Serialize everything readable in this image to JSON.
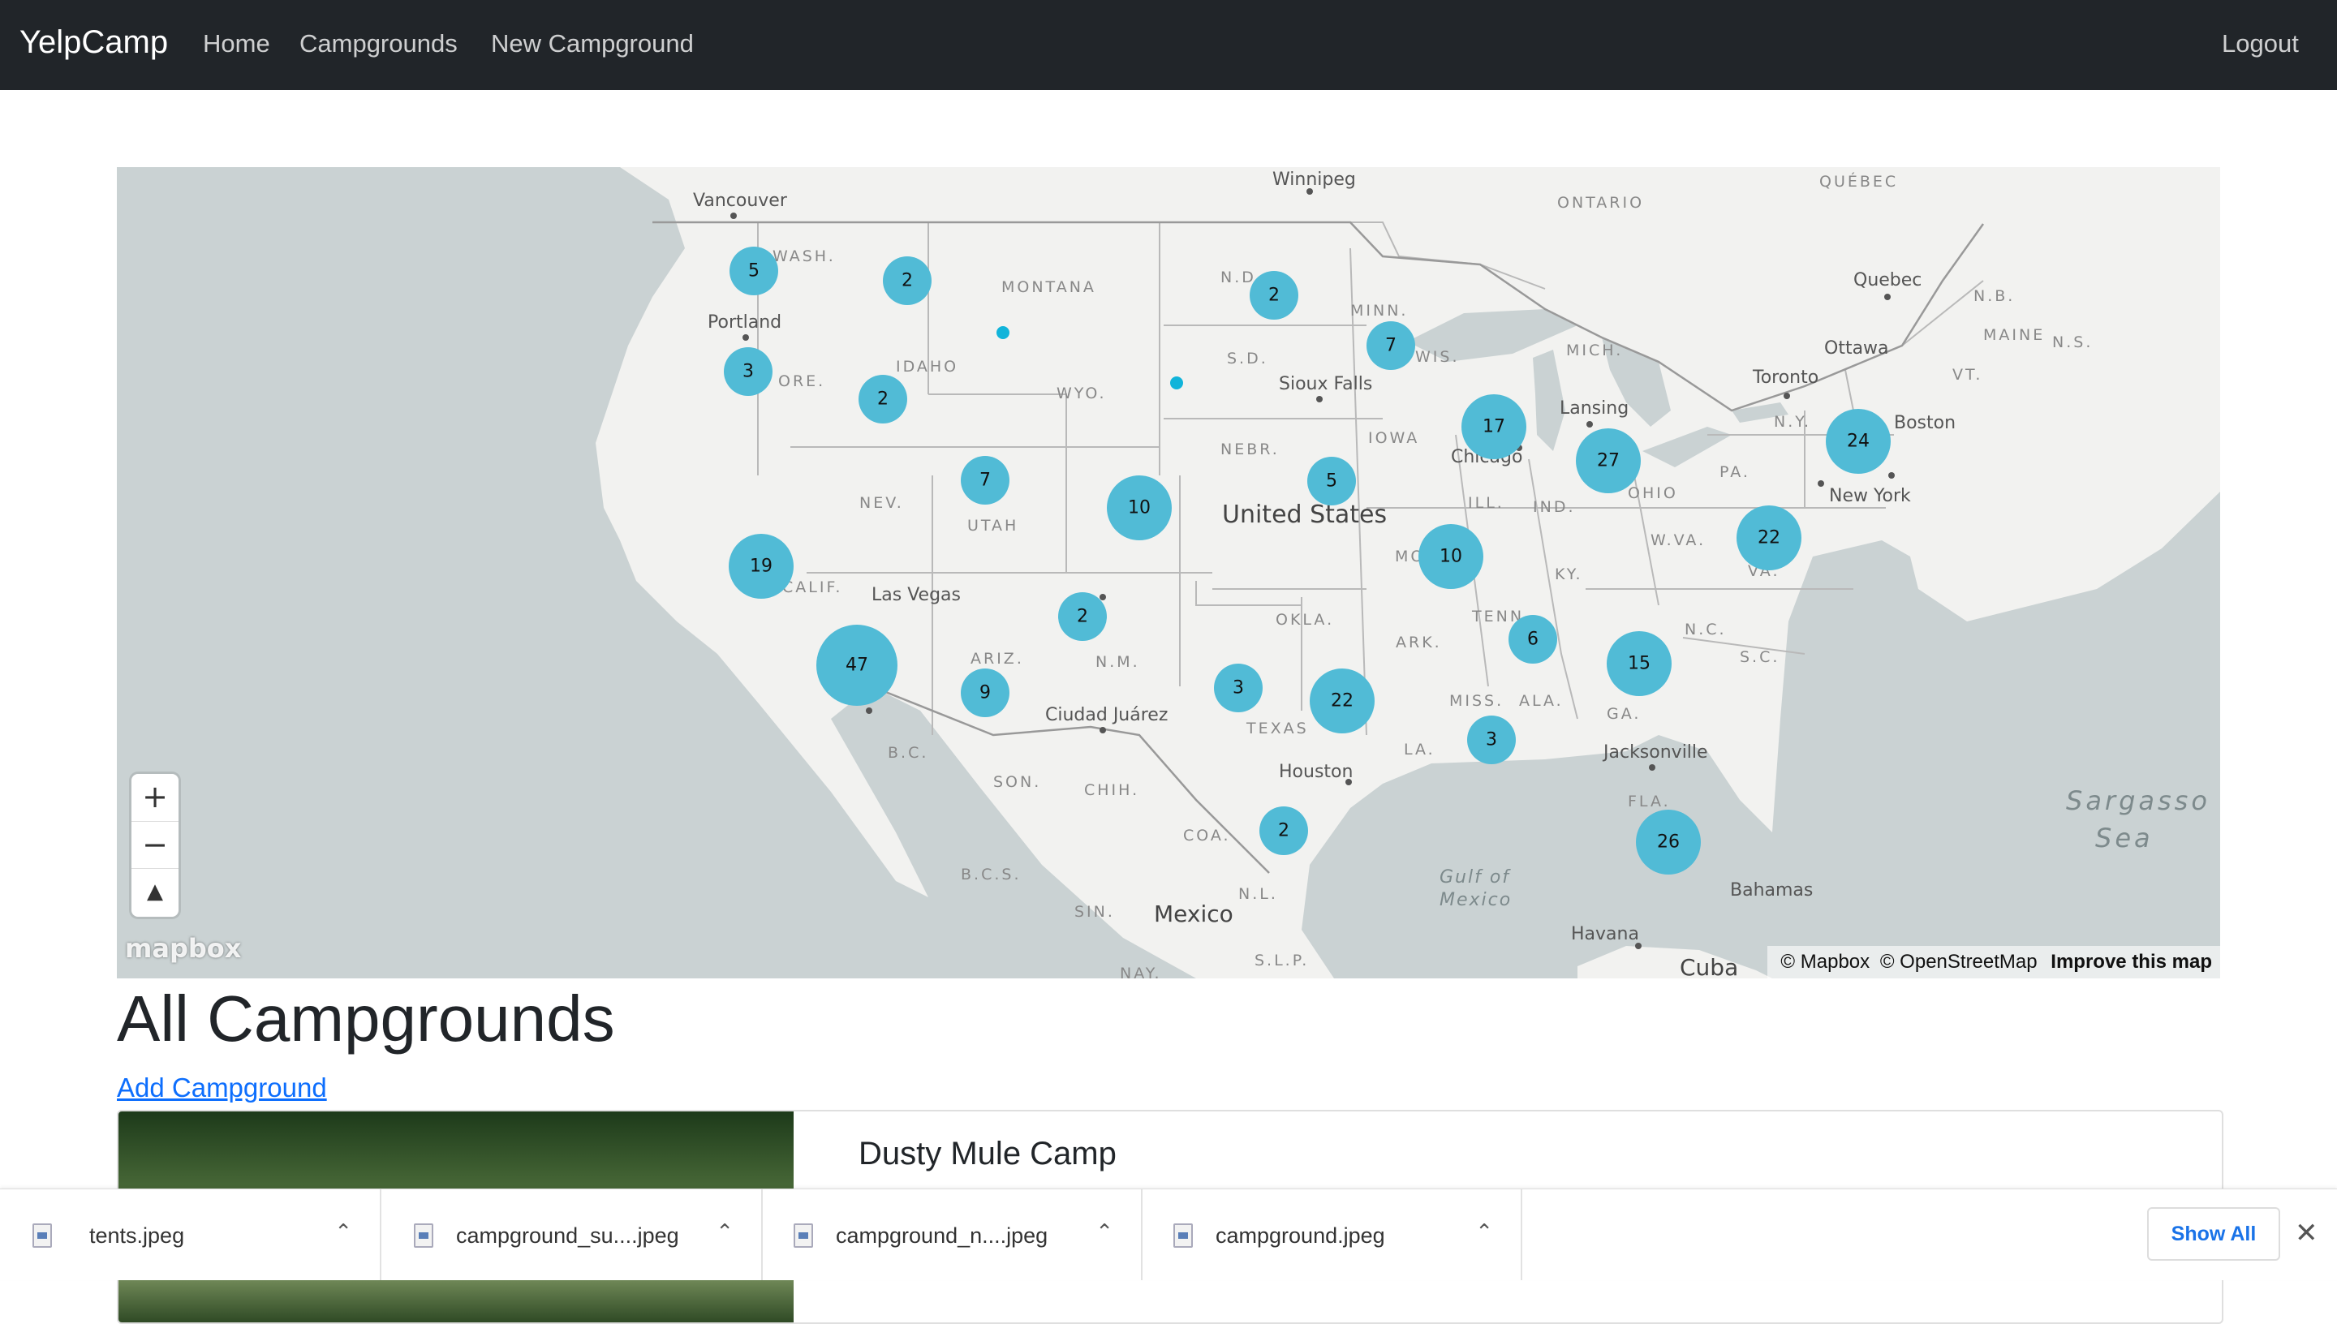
{
  "navbar": {
    "brand": "YelpCamp",
    "links": [
      "Home",
      "Campgrounds",
      "New Campground"
    ],
    "logout": "Logout"
  },
  "map": {
    "country_label": "United States",
    "city_labels": [
      "Vancouver",
      "Winnipeg",
      "Portland",
      "Quebec",
      "Ottawa",
      "Toronto",
      "Sioux Falls",
      "Chicago",
      "Lansing",
      "Boston",
      "New York",
      "Las Vegas",
      "Ciudad Juárez",
      "Houston",
      "Jacksonville",
      "Mexico",
      "Havana",
      "Bahamas",
      "Cuba"
    ],
    "region_labels": [
      "ONTARIO",
      "QUÉBEC",
      "WASH.",
      "MONTANA",
      "N.D.",
      "MINN.",
      "MAINE",
      "N.B.",
      "N.S.",
      "ORE.",
      "IDAHO",
      "WYO.",
      "S.D.",
      "WIS.",
      "MICH.",
      "VT.",
      "N.Y.",
      "NEBR.",
      "IOWA",
      "NEV.",
      "UTAH",
      "ILL.",
      "IND.",
      "OHIO",
      "PA.",
      "W.VA.",
      "VA.",
      "CALIF.",
      "MO.",
      "KY.",
      "OKLA.",
      "ARK.",
      "N.C.",
      "ARIZ.",
      "N.M.",
      "TENN.",
      "S.C.",
      "B.C.",
      "TEXAS",
      "MISS.",
      "ALA.",
      "GA.",
      "LA.",
      "SON.",
      "CHIH.",
      "FLA.",
      "COA.",
      "B.C.S.",
      "SIN.",
      "N.L.",
      "S.L.P.",
      "NAY."
    ],
    "sea_labels": [
      "Sargasso",
      "Sea",
      "Gulf of",
      "Mexico"
    ],
    "clusters": [
      "5",
      "2",
      "2",
      "7",
      "3",
      "2",
      "17",
      "27",
      "24",
      "7",
      "10",
      "5",
      "22",
      "19",
      "10",
      "2",
      "6",
      "15",
      "47",
      "9",
      "3",
      "22",
      "3",
      "26",
      "2"
    ],
    "zoom_in": "+",
    "zoom_out": "−",
    "compass": "▲",
    "logo": "mapbox",
    "attribution": [
      "© Mapbox",
      "© OpenStreetMap",
      "Improve this map"
    ],
    "colors": {
      "cluster": "#51bbd6",
      "land": "#f2f2f0",
      "water": "#cad2d3"
    }
  },
  "page": {
    "title": "All Campgrounds",
    "add_link": "Add Campground"
  },
  "card": {
    "title": "Dusty Mule Camp"
  },
  "downloads": {
    "items": [
      {
        "name": "tents.jpeg"
      },
      {
        "name": "campground_su....jpeg"
      },
      {
        "name": "campground_n....jpeg"
      },
      {
        "name": "campground.jpeg"
      }
    ],
    "chevron": "⌃",
    "show_all": "Show All",
    "close": "✕"
  }
}
